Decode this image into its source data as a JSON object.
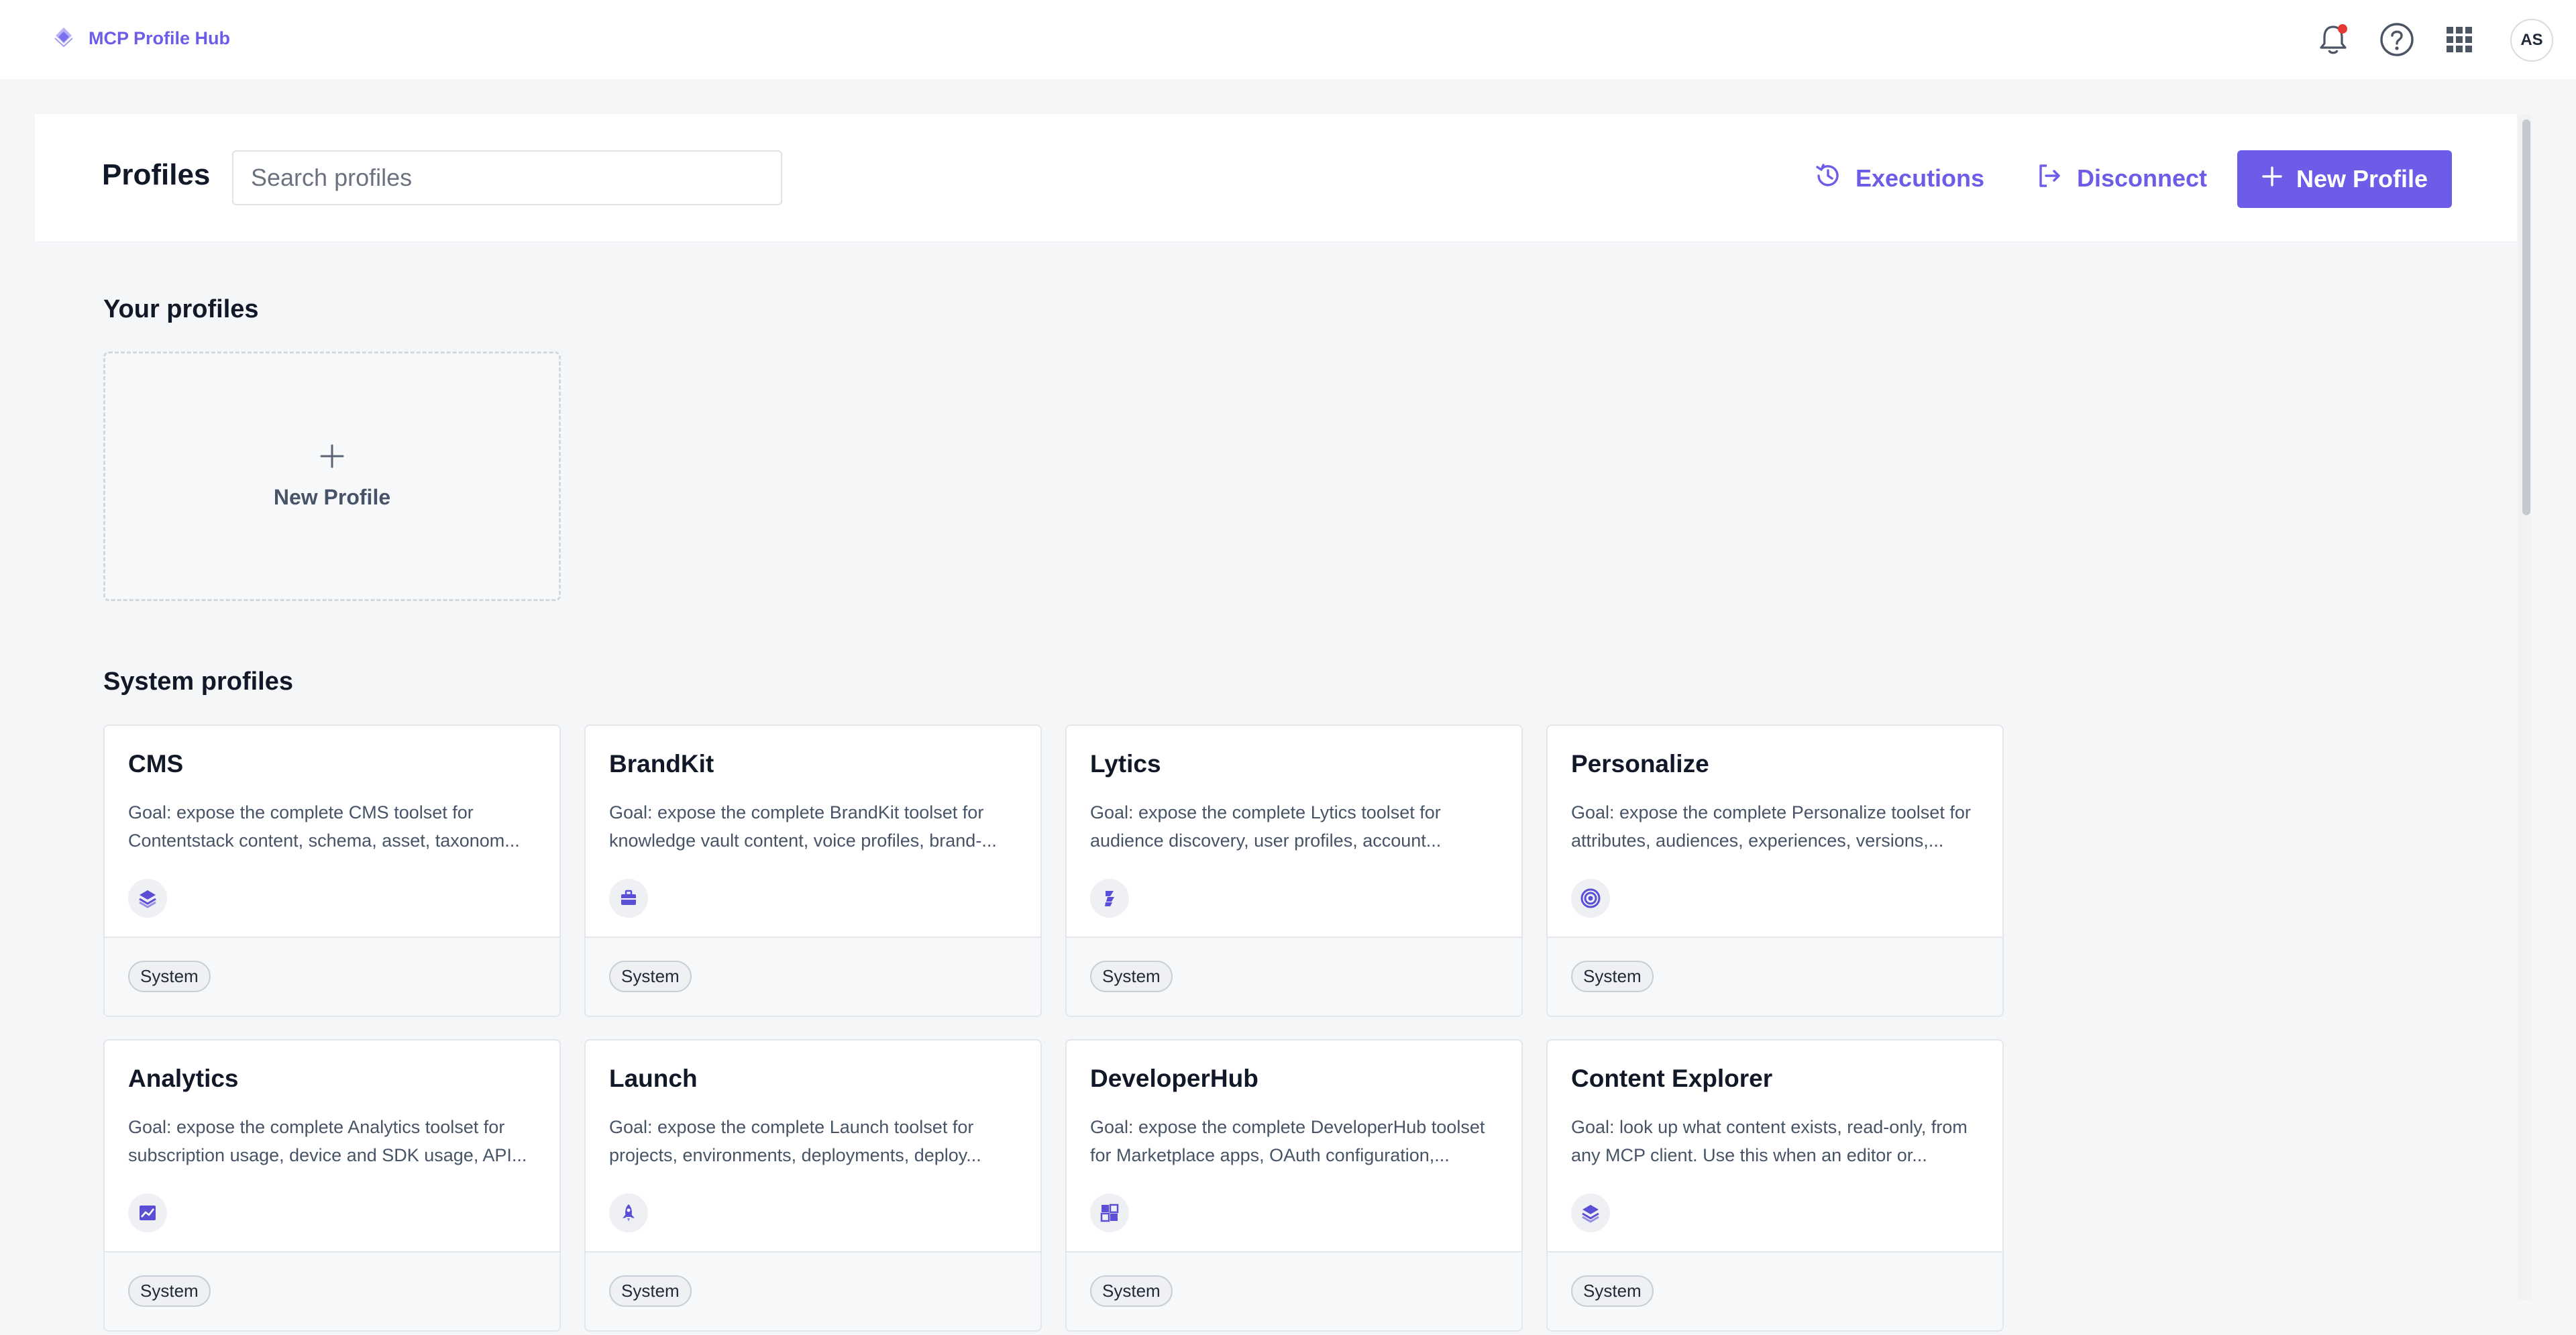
{
  "app": {
    "title": "MCP Profile Hub"
  },
  "user": {
    "initials": "AS"
  },
  "colors": {
    "accent": "#6c5ce7",
    "notification_dot": "#e53935"
  },
  "header": {
    "title": "Profiles",
    "search_placeholder": "Search profiles",
    "search_value": "",
    "executions_label": "Executions",
    "disconnect_label": "Disconnect",
    "new_profile_label": "New Profile"
  },
  "your_profiles": {
    "title": "Your profiles",
    "new_profile_card_label": "New Profile"
  },
  "system_profiles": {
    "title": "System profiles",
    "items": [
      {
        "name": "CMS",
        "description": "Goal: expose the complete CMS toolset for Contentstack content, schema, asset, taxonom...",
        "icon": "layers-icon",
        "badge": "System"
      },
      {
        "name": "BrandKit",
        "description": "Goal: expose the complete BrandKit toolset for knowledge vault content, voice profiles, brand-...",
        "icon": "toolbox-icon",
        "badge": "System"
      },
      {
        "name": "Lytics",
        "description": "Goal: expose the complete Lytics toolset for audience discovery, user profiles, account...",
        "icon": "lytics-icon",
        "badge": "System"
      },
      {
        "name": "Personalize",
        "description": "Goal: expose the complete Personalize toolset for attributes, audiences, experiences, versions,...",
        "icon": "target-icon",
        "badge": "System"
      },
      {
        "name": "Analytics",
        "description": "Goal: expose the complete Analytics toolset for subscription usage, device and SDK usage, API...",
        "icon": "chart-icon",
        "badge": "System"
      },
      {
        "name": "Launch",
        "description": "Goal: expose the complete Launch toolset for projects, environments, deployments, deploy...",
        "icon": "rocket-icon",
        "badge": "System"
      },
      {
        "name": "DeveloperHub",
        "description": "Goal: expose the complete DeveloperHub toolset for Marketplace apps, OAuth configuration,...",
        "icon": "apps-icon",
        "badge": "System"
      },
      {
        "name": "Content Explorer",
        "description": "Goal: look up what content exists, read-only, from any MCP client. Use this when an editor or...",
        "icon": "layers-icon",
        "badge": "System"
      }
    ]
  }
}
